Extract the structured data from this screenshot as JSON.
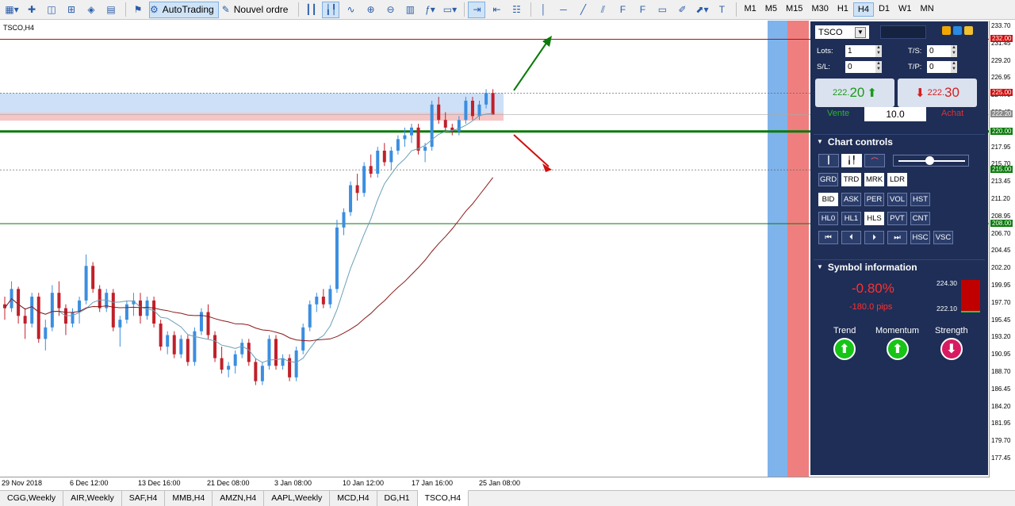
{
  "toolbar": {
    "autotrading_label": "AutoTrading",
    "new_order_label": "Nouvel ordre",
    "timeframes": [
      "M1",
      "M5",
      "M15",
      "M30",
      "H1",
      "H4",
      "D1",
      "W1",
      "MN"
    ],
    "active_timeframe": "H4"
  },
  "chart": {
    "label": "TSCO,H4",
    "price_labels": [
      "233.70",
      "231.45",
      "229.20",
      "226.95",
      "224.70",
      "222.45",
      "217.95",
      "215.70",
      "213.45",
      "211.20",
      "208.95",
      "206.70",
      "204.45",
      "202.20",
      "199.95",
      "197.70",
      "195.45",
      "193.20",
      "190.95",
      "188.70",
      "186.45",
      "184.20",
      "181.95",
      "179.70",
      "177.45"
    ],
    "badges": {
      "b232": "232.00",
      "b225": "225.00",
      "b222": "222.20",
      "b220": "220.00",
      "b215": "215.00",
      "b208": "208.00"
    },
    "time_labels": [
      "29 Nov 2018",
      "6 Dec 12:00",
      "13 Dec 16:00",
      "21 Dec 08:00",
      "3 Jan 08:00",
      "10 Jan 12:00",
      "17 Jan 16:00",
      "25 Jan 08:00"
    ],
    "colors": {
      "bull": "#3b8ee0",
      "bear": "#c0202a",
      "ma_fast": "#6aa0b8",
      "ma_slow": "#8b1a1a",
      "support": "#0a7a0a",
      "resistance": "#b01010"
    }
  },
  "tabs": [
    "CGG,Weekly",
    "AIR,Weekly",
    "SAF,H4",
    "MMB,H4",
    "AMZN,H4",
    "AAPL,Weekly",
    "MCD,H4",
    "DG,H1",
    "TSCO,H4"
  ],
  "active_tab": "TSCO,H4",
  "panel": {
    "symbol": "TSCO",
    "lots_label": "Lots:",
    "lots_value": "1",
    "sl_label": "S/L:",
    "sl_value": "0",
    "ts_label": "T/S:",
    "ts_value": "0",
    "tp_label": "T/P:",
    "tp_value": "0",
    "sell_small": "222.",
    "sell_big": "20",
    "buy_small": "222.",
    "buy_big": "30",
    "sell_label": "Vente",
    "buy_label": "Achat",
    "volume": "10.0",
    "chart_controls_title": "Chart controls",
    "controls_row1": [
      "GRD",
      "TRD",
      "MRK",
      "LDR"
    ],
    "controls_row2": [
      "BID",
      "ASK",
      "PER",
      "VOL",
      "HST"
    ],
    "controls_row3": [
      "HL0",
      "HL1",
      "HLS",
      "PVT",
      "CNT"
    ],
    "controls_row4_text": [
      "HSC",
      "VSC"
    ],
    "symbol_info_title": "Symbol information",
    "change_pct": "-0.80%",
    "change_pips": "-180.0 pips",
    "range_high": "224.30",
    "range_low": "222.10",
    "trend_label": "Trend",
    "momentum_label": "Momentum",
    "strength_label": "Strength"
  }
}
